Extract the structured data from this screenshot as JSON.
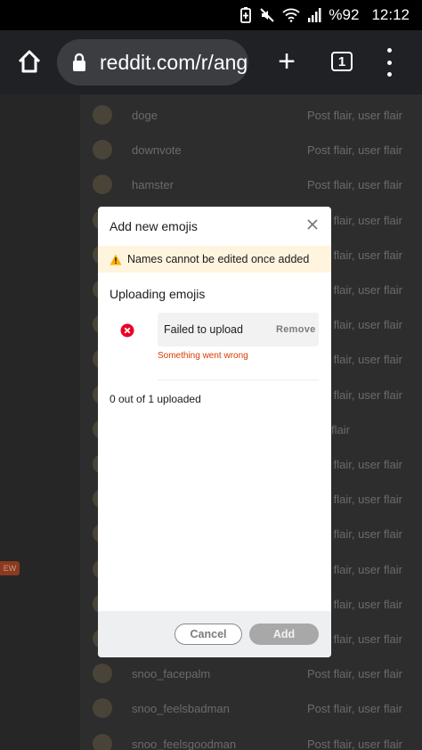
{
  "status_bar": {
    "battery": "%92",
    "time": "12:12"
  },
  "browser": {
    "url": "reddit.com/r/ang",
    "tab_count": "1"
  },
  "background_list": {
    "rows": [
      {
        "name": "doge",
        "flair": "Post flair, user flair"
      },
      {
        "name": "downvote",
        "flair": "Post flair, user flair"
      },
      {
        "name": "hamster",
        "flair": "Post flair, user flair"
      },
      {
        "name": "",
        "flair": "Post flair, user flair"
      },
      {
        "name": "",
        "flair": "Post flair, user flair"
      },
      {
        "name": "",
        "flair": "Post flair, user flair"
      },
      {
        "name": "",
        "flair": "Post flair, user flair"
      },
      {
        "name": "",
        "flair": "Post flair, user flair"
      },
      {
        "name": "",
        "flair": "Post flair, user flair"
      },
      {
        "name": "",
        "flair": "flair"
      },
      {
        "name": "",
        "flair": "Post flair, user flair"
      },
      {
        "name": "",
        "flair": "Post flair, user flair"
      },
      {
        "name": "",
        "flair": "Post flair, user flair"
      },
      {
        "name": "",
        "flair": "Post flair, user flair"
      },
      {
        "name": "",
        "flair": "Post flair, user flair"
      },
      {
        "name": "",
        "flair": "Post flair, user flair"
      },
      {
        "name": "snoo_facepalm",
        "flair": "Post flair, user flair"
      },
      {
        "name": "snoo_feelsbadman",
        "flair": "Post flair, user flair"
      },
      {
        "name": "snoo_feelsgoodman",
        "flair": "Post flair, user flair"
      }
    ],
    "new_badge": "EW"
  },
  "modal": {
    "title": "Add new emojis",
    "warning": "Names cannot be edited once added",
    "section_title": "Uploading emojis",
    "upload_item": {
      "status": "Failed to upload",
      "remove_label": "Remove",
      "error": "Something went wrong"
    },
    "progress_text": "0 out of 1 uploaded",
    "cancel_label": "Cancel",
    "add_label": "Add"
  },
  "colors": {
    "warning_bg": "#fff4de",
    "error": "#d93a00",
    "footer_bg": "#edeff1"
  }
}
